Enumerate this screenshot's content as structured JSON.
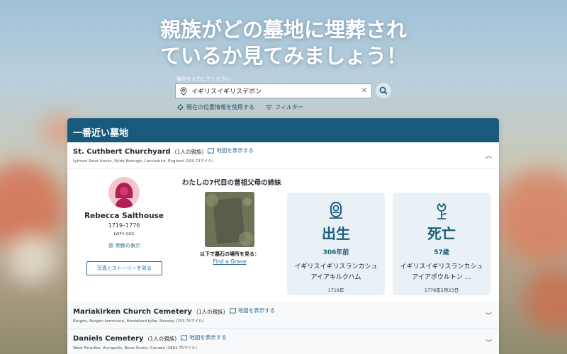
{
  "hero": {
    "line1": "親族がどの墓地に埋葬され",
    "line2": "ているか見てみましょう！"
  },
  "search": {
    "label": "場所を入力してください",
    "value": "イギリスイギリスデボン",
    "clear_icon": "clear-icon",
    "button_icon": "search-icon"
  },
  "links": {
    "use_location": "現在の位置情報を使用する",
    "filter": "フィルター"
  },
  "panel": {
    "title": "一番近い墓地"
  },
  "cemeteries": [
    {
      "name": "St. Cuthbert Churchyard",
      "count": "(1人の親族)",
      "map_link": "地図を表示する",
      "address": "Lytham Saint Annes, Fylde Borough, Lancashire, England (209.73マイル)"
    },
    {
      "name": "Mariakirken Church Cemetery",
      "count": "(1人の親族)",
      "map_link": "地図を表示する",
      "address": "Bergen, Bergen kommune, Hordaland fylke, Norway (753.74マイル)"
    },
    {
      "name": "Daniels Cemetery",
      "count": "(1人の親族)",
      "map_link": "地図を表示する",
      "address": "West Paradise, Annapolis, Nova Scotia, Canada (2801.75マイル)"
    }
  ],
  "person": {
    "name": "Rebecca Salthouse",
    "years": "1719–1776",
    "id": "LWF4-QGK",
    "relation_link": "関係の表示",
    "story_button": "写真とストーリーを見る",
    "relation_title": "わたしの7代目の曾祖父母の姉妹"
  },
  "grave": {
    "caption": "以下で墓石の場所を見る：",
    "link": "Find a Grave"
  },
  "cards": {
    "birth": {
      "label": "出生",
      "stat": "306年前",
      "place": "イギリスイギリスランカシュアイアキルクハム",
      "date": "1719年"
    },
    "death": {
      "label": "死亡",
      "stat": "57歳",
      "place": "イギリスイギリスランカシュアイアポウルトン …",
      "date": "1776年2月23日"
    }
  },
  "colors": {
    "header": "#175a7c",
    "accent": "#2a6b93",
    "card_bg": "#eaf1f6"
  }
}
